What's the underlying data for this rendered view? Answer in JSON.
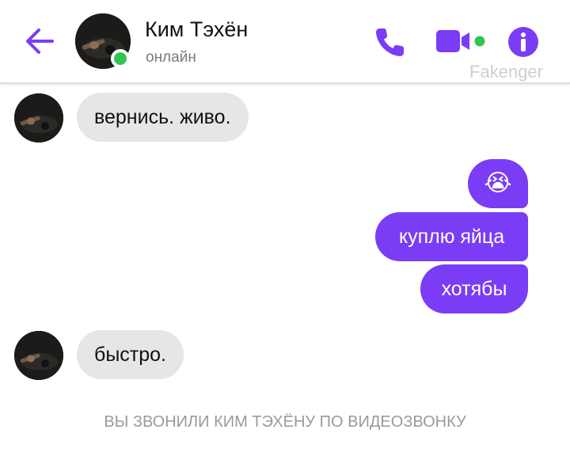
{
  "header": {
    "contact_name": "Ким Тэхён",
    "status": "онлайн",
    "watermark": "Fakenger"
  },
  "colors": {
    "accent": "#7b3cf5",
    "online": "#31c451",
    "incoming_bubble": "#e6e6e6"
  },
  "messages": [
    {
      "direction": "incoming",
      "text": "вернись. живо."
    },
    {
      "direction": "outgoing",
      "text": "😭"
    },
    {
      "direction": "outgoing",
      "text": "куплю яйца"
    },
    {
      "direction": "outgoing",
      "text": "хотябы"
    },
    {
      "direction": "incoming",
      "text": "быстро."
    }
  ],
  "call_note": "ВЫ ЗВОНИЛИ КИМ ТЭХЁНУ ПО ВИДЕОЗВОНКУ",
  "icons": [
    "back-arrow-icon",
    "phone-icon",
    "video-camera-icon",
    "info-icon"
  ]
}
